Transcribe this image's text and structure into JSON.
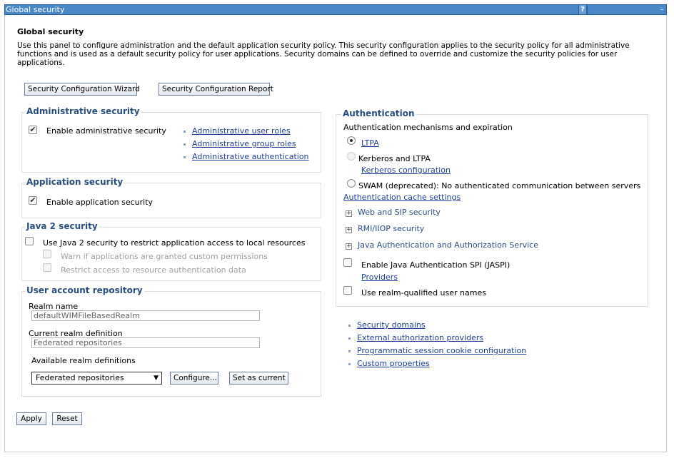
{
  "window": {
    "title": "Global security",
    "help_label": "?",
    "minimize_label": "–"
  },
  "page": {
    "title": "Global security",
    "description": "Use this panel to configure administration and the default application security policy. This security configuration applies to the security policy for all administrative functions and is used as a default security policy for user applications. Security domains can be defined to override and customize the security policies for user applications."
  },
  "toolbar": {
    "wizard_label": "Security Configuration Wizard",
    "report_label": "Security Configuration Report"
  },
  "admin_security": {
    "legend": "Administrative security",
    "enable_label": "Enable administrative security",
    "enabled": true,
    "links": [
      "Administrative user roles",
      "Administrative group roles",
      "Administrative authentication"
    ]
  },
  "app_security": {
    "legend": "Application security",
    "enable_label": "Enable application security",
    "enabled": true
  },
  "java2_security": {
    "legend": "Java 2 security",
    "use_label": "Use Java 2 security to restrict application access to local resources",
    "warn_label": "Warn if applications are granted custom permissions",
    "restrict_label": "Restrict access to resource authentication data"
  },
  "user_repo": {
    "legend": "User account repository",
    "realm_name_label": "Realm name",
    "realm_name_value": "defaultWIMFileBasedRealm",
    "current_realm_label": "Current realm definition",
    "current_realm_value": "Federated repositories",
    "available_label": "Available realm definitions",
    "available_selected": "Federated repositories",
    "configure_label": "Configure...",
    "set_current_label": "Set as current"
  },
  "authentication": {
    "legend": "Authentication",
    "subtitle": "Authentication mechanisms and expiration",
    "ltpa_label": "LTPA",
    "kerberos_label": "Kerberos and LTPA",
    "kerberos_config_link": "Kerberos configuration",
    "swam_label": "SWAM (deprecated): No authenticated communication between servers",
    "cache_link": "Authentication cache settings",
    "web_sip_label": "Web and SIP security",
    "rmi_label": "RMI/IIOP security",
    "jaas_label": "Java Authentication and Authorization Service",
    "jaspi_label": "Enable Java Authentication SPI (JASPI)",
    "providers_link": "Providers",
    "realm_qualified_label": "Use realm-qualified user names"
  },
  "related_links": [
    "Security domains",
    "External authorization providers",
    "Programmatic session cookie configuration",
    "Custom properties"
  ],
  "footer": {
    "apply_label": "Apply",
    "reset_label": "Reset"
  },
  "colors": {
    "title_bar": "#4a88c8",
    "legend_text": "#2a4e80",
    "link": "#1f3f9a"
  }
}
